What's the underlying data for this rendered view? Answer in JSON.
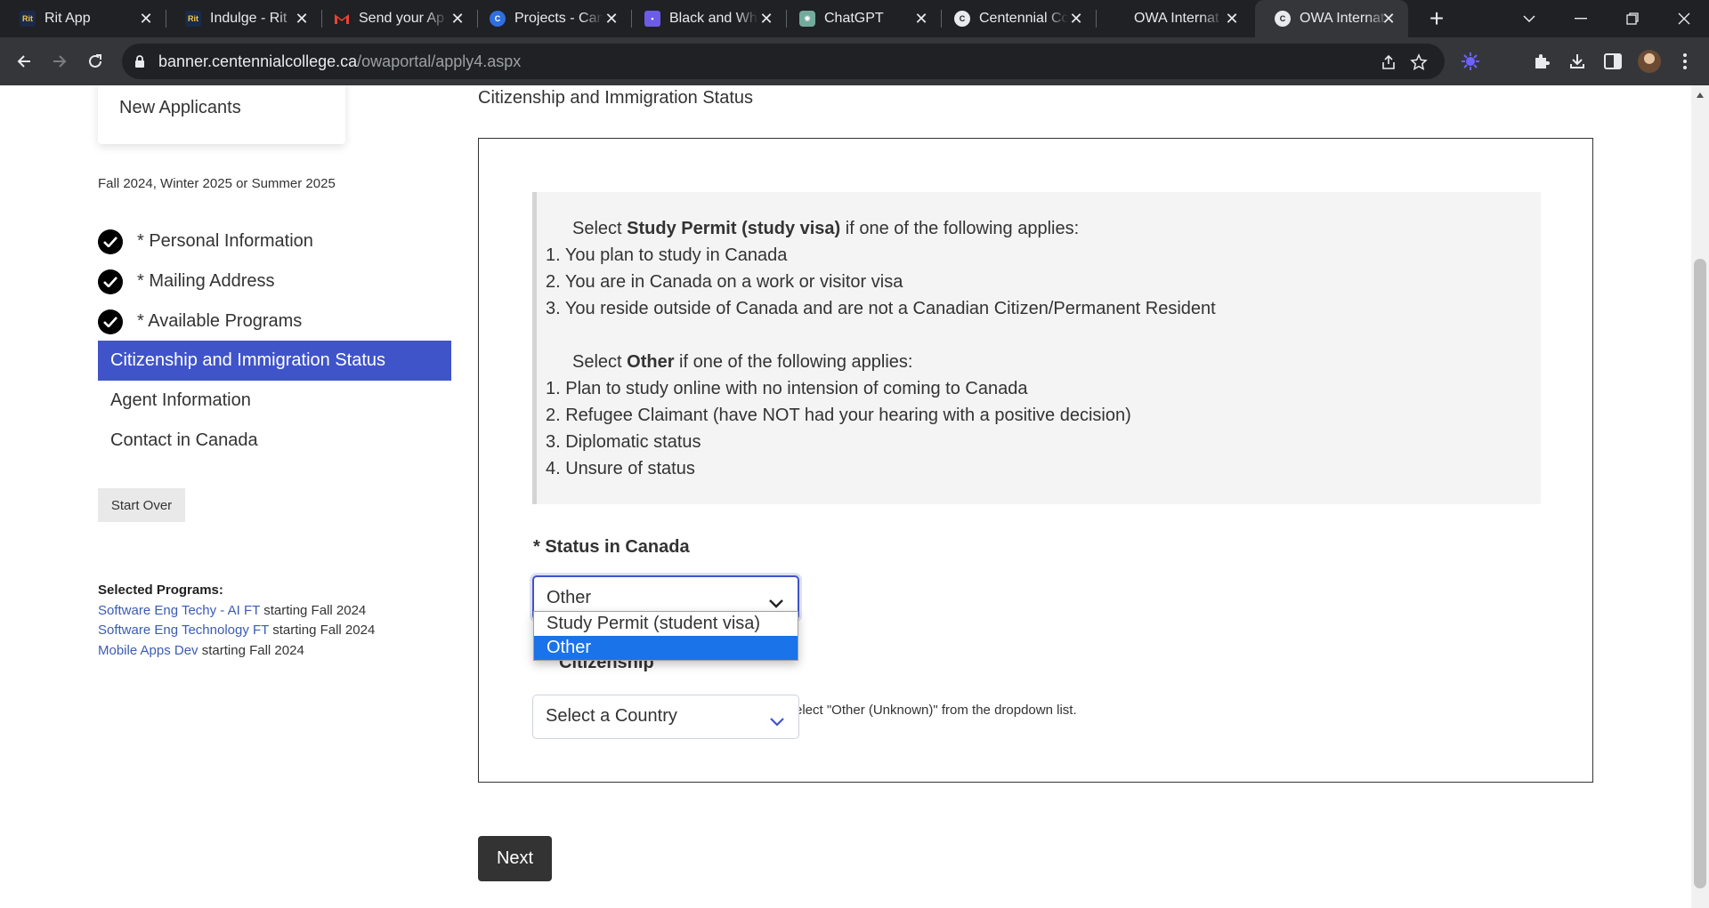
{
  "tabs": [
    {
      "title": "Rit App",
      "favicon": "rit-icon"
    },
    {
      "title": "Indulge - Rit",
      "favicon": "rit-icon"
    },
    {
      "title": "Send your Ap",
      "favicon": "gmail-icon"
    },
    {
      "title": "Projects - Can",
      "favicon": "canva-icon"
    },
    {
      "title": "Black and Wh",
      "favicon": "app-icon"
    },
    {
      "title": "ChatGPT",
      "favicon": "chatgpt-icon"
    },
    {
      "title": "Centennial Co",
      "favicon": "centennial-icon"
    },
    {
      "title": "OWA Internat",
      "favicon": "none"
    },
    {
      "title": "OWA Internat",
      "favicon": "centennial-icon",
      "active": true
    }
  ],
  "address_bar": {
    "domain": "banner.centennialcollege.ca",
    "path": "/owaportal/apply4.aspx"
  },
  "sidebar": {
    "new_applicants": "New Applicants",
    "term": "Fall 2024, Winter 2025 or Summer 2025",
    "steps": [
      {
        "label": "* Personal Information",
        "done": true
      },
      {
        "label": "* Mailing Address",
        "done": true
      },
      {
        "label": "* Available Programs",
        "done": true
      },
      {
        "label": "Citizenship and Immigration Status",
        "active": true
      },
      {
        "label": "Agent Information"
      },
      {
        "label": "Contact in Canada"
      }
    ],
    "start_over": "Start Over",
    "selected_title": "Selected Programs:",
    "selected_programs": [
      {
        "name": "Software Eng Techy - AI FT",
        "suffix": "starting Fall 2024"
      },
      {
        "name": "Software Eng Technology FT",
        "suffix": "starting Fall 2024"
      },
      {
        "name": "Mobile Apps Dev",
        "suffix": "starting Fall 2024"
      }
    ]
  },
  "main": {
    "heading": "Citizenship and Immigration Status",
    "info": {
      "study_intro_pre": "Select ",
      "study_bold": "Study Permit (study visa)",
      "study_intro_post": " if one of the following applies:",
      "study_items": [
        "1. You plan to study in Canada",
        "2. You are in Canada on a work or visitor visa",
        "3. You reside outside of Canada and are not a Canadian Citizen/Permanent Resident"
      ],
      "other_intro_pre": "Select ",
      "other_bold": "Other",
      "other_intro_post": " if one of the following applies:",
      "other_items": [
        "1. Plan to study online with no intension of coming to Canada",
        "2. Refugee Claimant (have NOT had your hearing with a positive decision)",
        "3. Diplomatic status",
        "4. Unsure of status"
      ]
    },
    "status_label": "* Status in Canada",
    "status_value": "Other",
    "status_options": [
      "Study Permit (student visa)",
      "Other"
    ],
    "hint_visible": "elect \"Other (Unknown)\" from the dropdown list.",
    "citizenship_label_visible": "Citizenship",
    "citizenship_value": "Select a Country",
    "next_label": "Next"
  }
}
